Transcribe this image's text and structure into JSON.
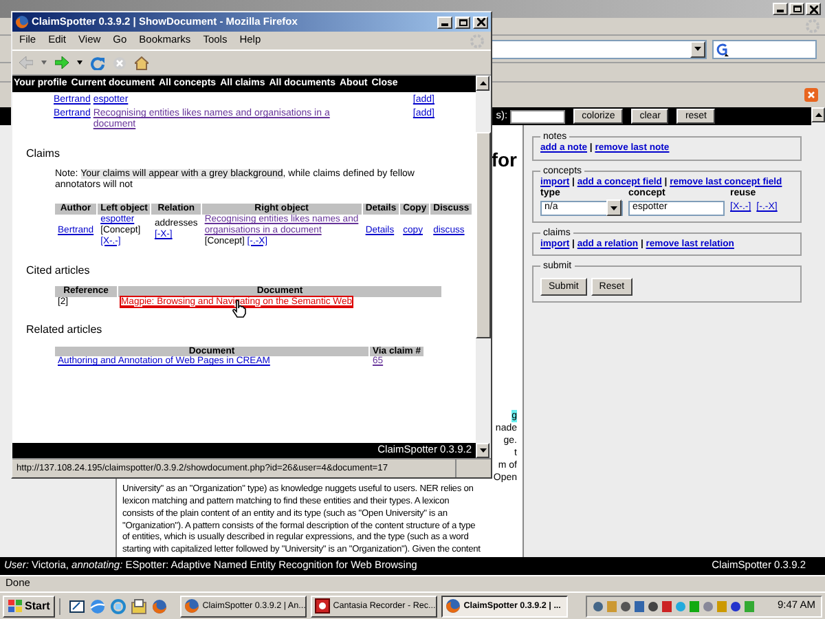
{
  "main_window": {
    "toolbar": {
      "label": "s):",
      "buttons": [
        "colorize",
        "clear",
        "reset"
      ]
    },
    "heading_fragment": "for",
    "text_fragments": [
      {
        "text": "g",
        "highlighted": true
      },
      {
        "text": "nade",
        "highlighted": false
      },
      {
        "text": "ge.",
        "highlighted": false
      },
      {
        "text": "t",
        "highlighted": false
      },
      {
        "text": "m of",
        "highlighted": false
      },
      {
        "text": "Open",
        "highlighted": false
      }
    ],
    "paragraph_lines": [
      "University\" as an \"Organization\" type) as knowledge nuggets useful to users. NER relies on",
      "lexicon matching and pattern matching to find these entities and their types. A lexicon",
      "consists of the plain content of an entity and its type (such as \"Open University\" is an",
      "\"Organization\"). A pattern consists of the formal description of the content structure of a type",
      "of entities, which is usually described in regular expressions, and the type (such as a word",
      "starting with capitalized letter followed by \"University\" is an \"Organization\").  Given the content"
    ],
    "side_panel": [
      {
        "kind": "links",
        "legend": "notes",
        "separator": "|",
        "links": [
          "add a note",
          "remove last note"
        ]
      },
      {
        "kind": "concepts",
        "legend": "concepts",
        "separator": "|",
        "links": [
          "import",
          "add a concept field",
          "remove last concept field"
        ],
        "columns": [
          "type",
          "concept",
          "reuse"
        ],
        "type_value": "n/a",
        "concept_value": "espotter",
        "reuse_links": [
          "[X-.-]",
          "[-.-X]"
        ]
      },
      {
        "kind": "links",
        "legend": "claims",
        "separator": "|",
        "links": [
          "import",
          "add a relation",
          "remove last relation"
        ]
      },
      {
        "kind": "buttons",
        "legend": "submit",
        "buttons": [
          "Submit",
          "Reset"
        ]
      }
    ],
    "user_bar": {
      "text": "*User:* Victoria, *annotating:* ESpotter: Adaptive Named Entity Recognition for Web Browsing",
      "version": "ClaimSpotter 0.3.9.2"
    },
    "status": "Done"
  },
  "popup": {
    "title": "ClaimSpotter 0.3.9.2 | ShowDocument - Mozilla Firefox",
    "menu": [
      "File",
      "Edit",
      "View",
      "Go",
      "Bookmarks",
      "Tools",
      "Help"
    ],
    "nav_links": [
      "Your profile",
      "Current document",
      "All concepts",
      "All claims",
      "All documents",
      "About",
      "Close"
    ],
    "concept_rows": [
      {
        "author": "Bertrand",
        "concept": "espotter",
        "visited": false,
        "action": "[add]"
      },
      {
        "author": "Bertrand",
        "concept": "Recognising entities likes names and organisations in a document",
        "visited": true,
        "action": "[add]"
      }
    ],
    "claims": {
      "title": "Claims",
      "note": {
        "lead": "Note: ",
        "highlighted": "Your claims will appear with a grey blackground",
        "rest": ", while claims defined by fellow annotators will not"
      },
      "columns": [
        "Author",
        "Left object",
        "Relation",
        "Right object",
        "Details",
        "Copy",
        "Discuss"
      ],
      "rows": [
        {
          "author": "Bertrand",
          "left": "espotter",
          "left_type": "[Concept]",
          "left_action": "[X-.-]",
          "relation": "addresses",
          "relation_action": "[-X-]",
          "right": "Recognising entities likes names and organisations in a document",
          "right_visited": true,
          "right_type": "[Concept]",
          "right_action": "[-.-X]",
          "details": "Details",
          "copy": "copy",
          "discuss": "discuss"
        }
      ]
    },
    "cited": {
      "title": "Cited articles",
      "columns": [
        "Reference",
        "Document"
      ],
      "rows": [
        {
          "reference": "[2]",
          "document": "Magpie: Browsing and Navigating on the Semantic Web",
          "hovered": true
        }
      ]
    },
    "related": {
      "title": "Related articles",
      "columns": [
        "Document",
        "Via claim #"
      ],
      "rows": [
        {
          "document": "Authoring and Annotation of Web Pages in CREAM",
          "claim": "65",
          "claim_visited": true
        }
      ]
    },
    "footer": "ClaimSpotter 0.3.9.2",
    "url": "http://137.108.24.195/claimspotter/0.3.9.2/showdocument.php?id=26&user=4&document=17"
  },
  "taskbar": {
    "start": "Start",
    "tasks": [
      {
        "kind": "browser",
        "label": "ClaimSpotter 0.3.9.2 | An...",
        "selected": false
      },
      {
        "kind": "recorder",
        "label": "Cantasia Recorder - Rec...",
        "selected": false
      },
      {
        "kind": "browser",
        "label": "ClaimSpotter 0.3.9.2 | ...",
        "selected": true
      }
    ],
    "clock": "9:47 AM"
  }
}
